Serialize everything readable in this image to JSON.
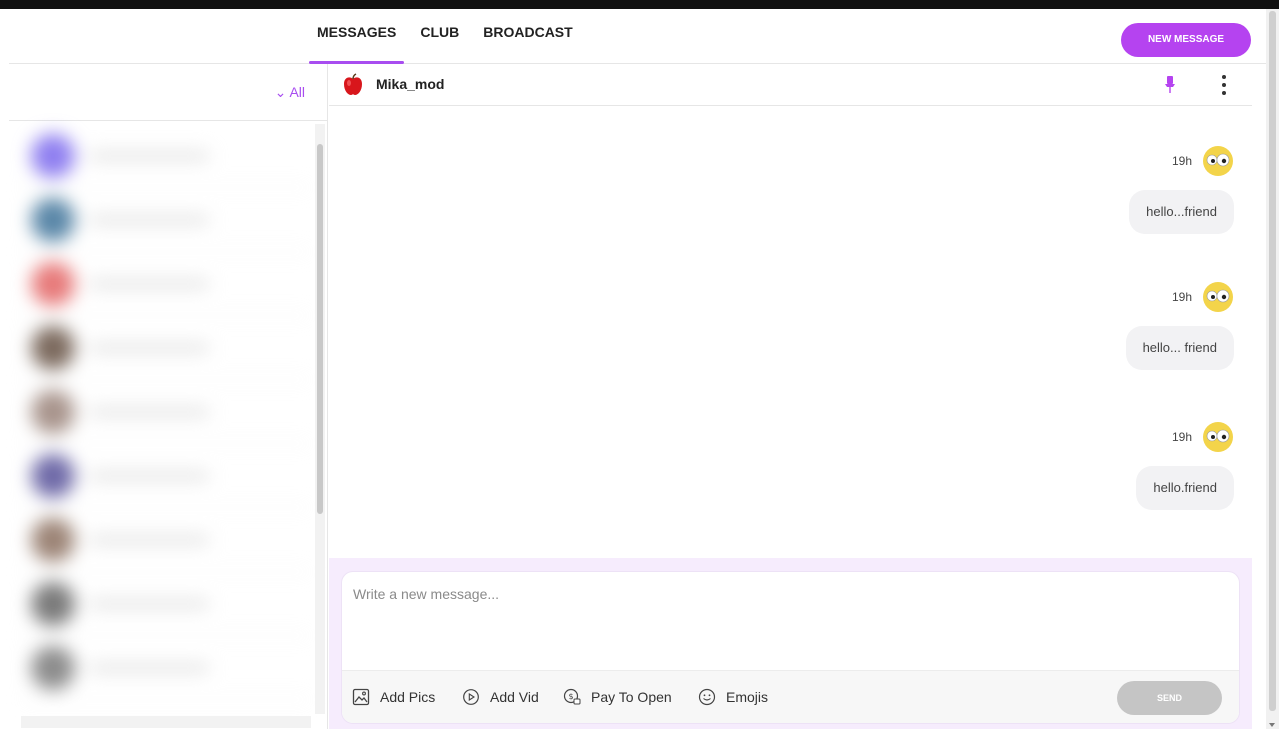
{
  "tabs": [
    {
      "label": "MESSAGES",
      "active": true
    },
    {
      "label": "CLUB",
      "active": false
    },
    {
      "label": "BROADCAST",
      "active": false
    }
  ],
  "header": {
    "new_message_label": "NEW MESSAGE"
  },
  "sidebar": {
    "filter_label": "⌄ All",
    "conversation_avatar_colors": [
      "#8f7ff0",
      "#5a87a8",
      "#e77a7a",
      "#7c6a5e",
      "#a8948c",
      "#6f6aa8",
      "#9c8476",
      "#7a7a7a",
      "#8c8c8c"
    ]
  },
  "chat": {
    "contact_name": "Mika_mod",
    "messages": [
      {
        "time": "19h",
        "text": "hello...friend"
      },
      {
        "time": "19h",
        "text": "hello... friend"
      },
      {
        "time": "19h",
        "text": "hello.friend"
      }
    ]
  },
  "composer": {
    "placeholder": "Write a new message...",
    "add_pics_label": "Add Pics",
    "add_vid_label": "Add Vid",
    "pay_to_open_label": "Pay To Open",
    "emojis_label": "Emojis",
    "send_label": "SEND"
  },
  "colors": {
    "accent": "#b543f0",
    "send_disabled": "#c5c5c5",
    "composer_bg": "#f6ecfd"
  }
}
